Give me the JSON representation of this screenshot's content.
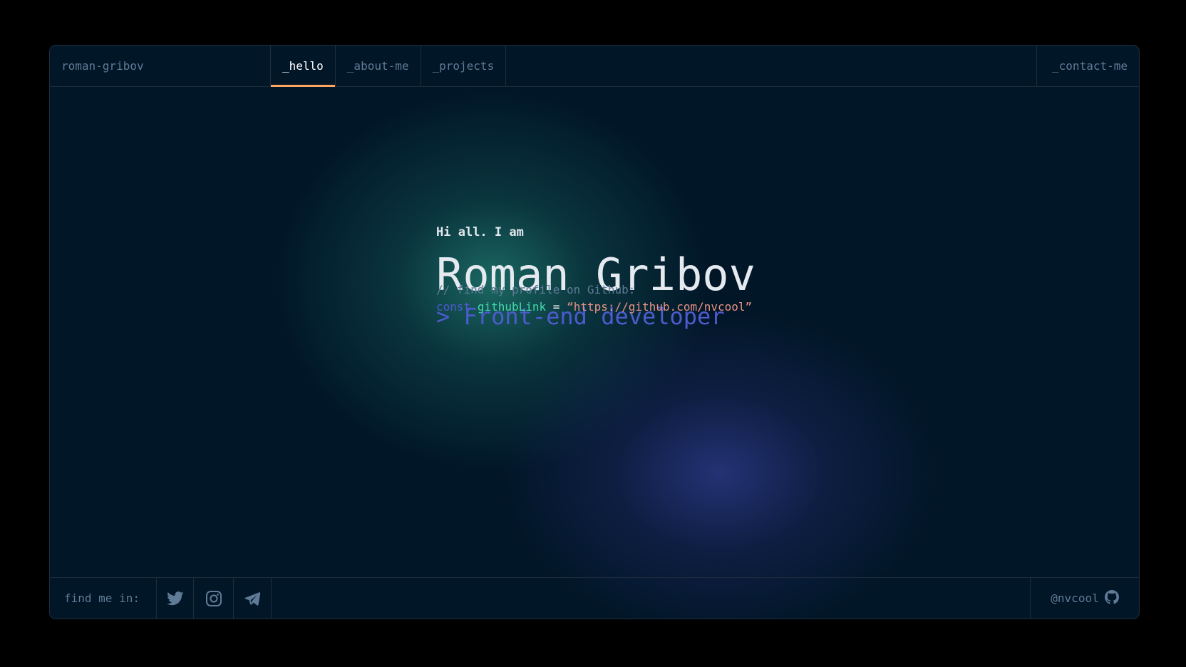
{
  "header": {
    "brand": "roman-gribov",
    "tabs": [
      {
        "label": "_hello",
        "active": true
      },
      {
        "label": "_about-me",
        "active": false
      },
      {
        "label": "_projects",
        "active": false
      }
    ],
    "contact_label": "_contact-me"
  },
  "hero": {
    "greeting": "Hi all. I am",
    "name": "Roman Gribov",
    "role": "> Front-end developer"
  },
  "code": {
    "comment": "// find my profile on Github:",
    "keyword": "const",
    "variable": "githubLink",
    "operator": "=",
    "value": "“https://github.com/nvcool”"
  },
  "footer": {
    "find_label": "find me in:",
    "socials": [
      {
        "icon": "twitter-icon"
      },
      {
        "icon": "instagram-icon"
      },
      {
        "icon": "telegram-icon"
      }
    ],
    "github_handle": "@nvcool",
    "github_icon": "github-icon"
  },
  "colors": {
    "background": "#011627",
    "border": "#1E2D3D",
    "muted_text": "#607B96",
    "accent_orange": "#FEA55F",
    "accent_indigo": "#4D5BCE",
    "accent_green": "#43D9AD",
    "string_salmon": "#E99287"
  }
}
